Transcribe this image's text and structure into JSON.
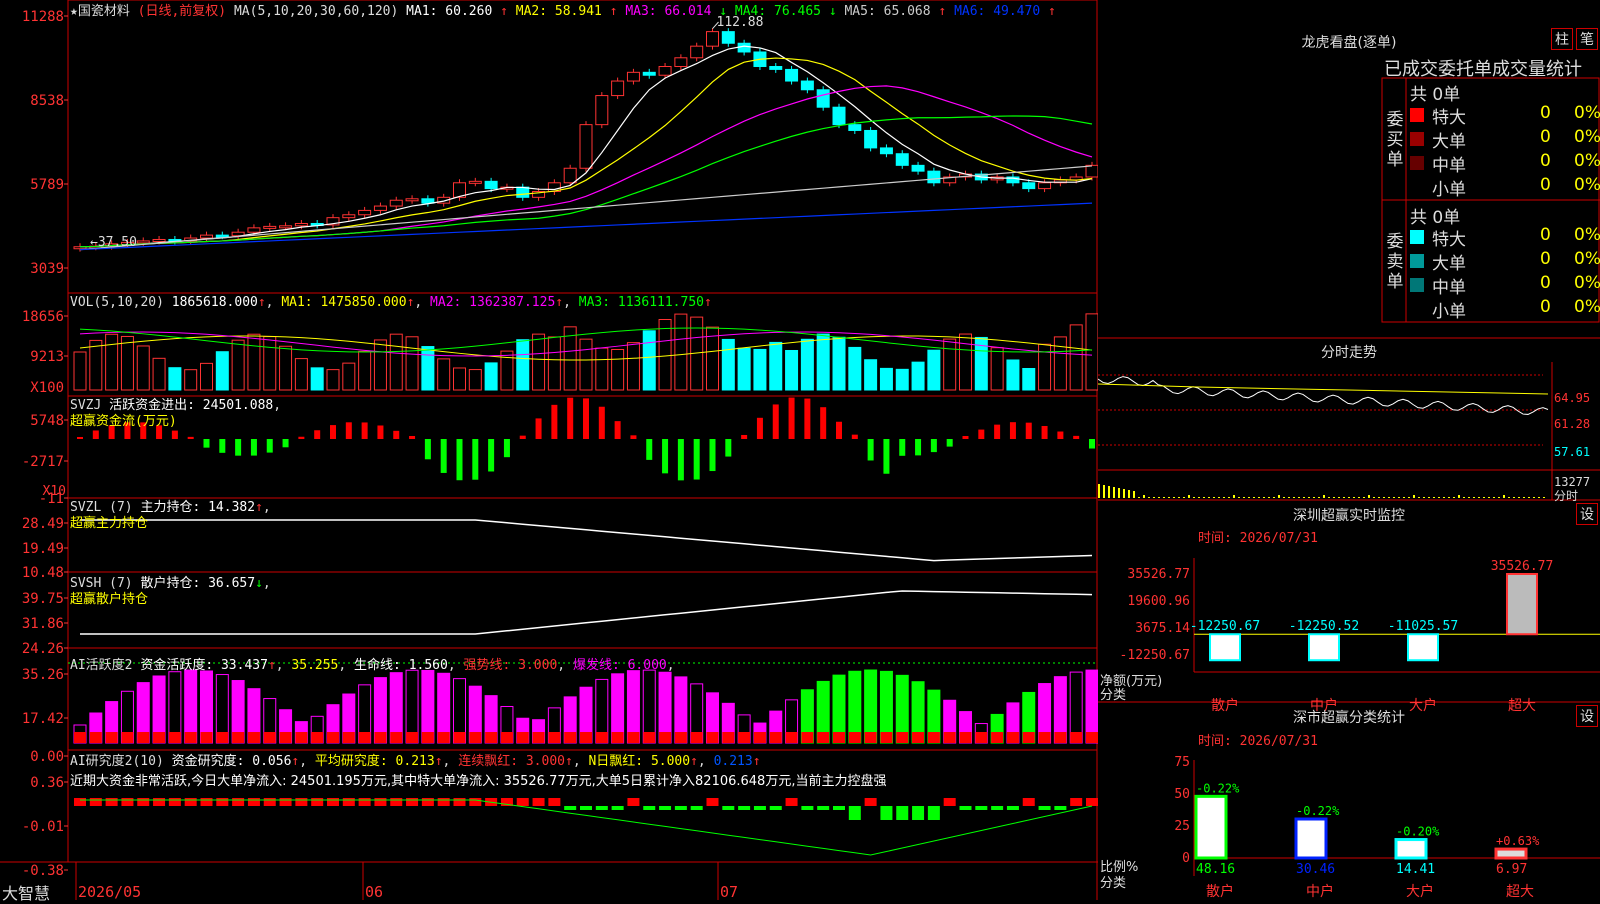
{
  "colors": {
    "up": "#ff3333",
    "down": "#00ffff",
    "red": "#ff0000",
    "green": "#00ff00",
    "magenta": "#ff00ff",
    "yellow": "#ffff00",
    "white": "#ffffff",
    "blue": "#0033ff",
    "border": "#cc0000"
  },
  "main": {
    "title": "★国瓷材料",
    "title_icon": "star-icon",
    "mode": "(日线,前复权)",
    "ma_label": "MA(5,10,20,30,60,120)",
    "ma_items": [
      {
        "text": "MA1: 60.260",
        "arrow": "↑",
        "color": "#ffffff"
      },
      {
        "text": "MA2: 58.941",
        "arrow": "↑",
        "color": "#ffff00"
      },
      {
        "text": "MA3: 66.014",
        "arrow": "↓",
        "color": "#ff00ff"
      },
      {
        "text": "MA4: 76.465",
        "arrow": "↓",
        "color": "#00ff00"
      },
      {
        "text": "MA5: 65.068",
        "arrow": "↑",
        "color": "#cccccc"
      },
      {
        "text": "MA6: 49.470",
        "arrow": "↑",
        "color": "#0033ff"
      }
    ],
    "y_ticks": [
      "11288",
      "8538",
      "5789",
      "3039"
    ],
    "high_label": "112.88",
    "low_label": "37.50",
    "volume": {
      "title": "VOL(5,10,20)",
      "value": "1865618.000",
      "arrow": "↑",
      "ma1": "MA1: 1475850.000",
      "ma2": "MA2: 1362387.125",
      "ma3": "MA3: 1136111.750",
      "y_ticks": [
        "18656",
        "9213"
      ],
      "unit": "X100"
    },
    "svzj": {
      "title": "SVZJ",
      "label": "活跃资金进出: 24501.088",
      "suffix": ",",
      "line2": "超赢资金流(万元)",
      "y_ticks": [
        "5748",
        "-2717",
        "-11"
      ],
      "unit": "X10"
    },
    "svzl": {
      "title": "SVZL (7)",
      "label": "主力持仓: 14.382",
      "arrow": "↑",
      "suffix": ",",
      "line2": "超赢主力持仓",
      "y_ticks": [
        "28.49",
        "19.49",
        "10.48"
      ]
    },
    "svsh": {
      "title": "SVSH (7)",
      "label": "散户持仓: 36.657",
      "arrow": "↓",
      "suffix": ",",
      "line2": "超赢散户持仓",
      "y_ticks": [
        "39.75",
        "31.86",
        "24.26"
      ]
    },
    "ai_active": {
      "title": "AI活跃度2",
      "label": "资金活跃度: 33.437",
      "arrow1": "↑",
      "v2": "35.255",
      "life": "生命线: 1.560",
      "strong": "强势线: 3.000",
      "burst": "爆发线: 6.000",
      "y_ticks": [
        "35.26",
        "17.42",
        "0.00"
      ]
    },
    "ai_research": {
      "title": "AI研究度2(10)",
      "label": "资金研究度: 0.056",
      "arrow1": "↑",
      "avg": "平均研究度: 0.213",
      "consec": "连续飘红: 3.000",
      "nday": "N日飘红: 5.000",
      "last": "0.213",
      "summary": "近期大资金非常活跃,今日大单净流入: 24501.195万元,其中特大单净流入: 35526.77万元,大单5日累计净入82106.648万元,当前主力控盘强",
      "y_ticks": [
        "0.36",
        "-0.01",
        "-0.38"
      ]
    },
    "x_labels": [
      "2026/05",
      "06",
      "07"
    ],
    "brand": "大智慧",
    "lock_icon": "lock-icon"
  },
  "right": {
    "lhb_title": "龙虎看盘(逐单)",
    "btn_bar": "柱",
    "btn_pen": "笔",
    "stats_header": "已成交委托单成交量统计",
    "buy": {
      "side": "委买单",
      "total": "共 0单",
      "rows": [
        {
          "label": "特大",
          "count": "0",
          "pct": "0%",
          "color": "#ff0000"
        },
        {
          "label": "大单",
          "count": "0",
          "pct": "0%",
          "color": "#990000"
        },
        {
          "label": "中单",
          "count": "0",
          "pct": "0%",
          "color": "#660000"
        },
        {
          "label": "小单",
          "count": "0",
          "pct": "0%",
          "color": ""
        }
      ]
    },
    "sell": {
      "side": "委卖单",
      "total": "共 0单",
      "rows": [
        {
          "label": "特大",
          "count": "0",
          "pct": "0%",
          "color": "#00ffff"
        },
        {
          "label": "大单",
          "count": "0",
          "pct": "0%",
          "color": "#009999"
        },
        {
          "label": "中单",
          "count": "0",
          "pct": "0%",
          "color": "#007777"
        },
        {
          "label": "小单",
          "count": "0",
          "pct": "0%",
          "color": ""
        }
      ]
    },
    "intraday": {
      "title": "分时走势",
      "price_ticks": [
        "64.95",
        "61.28",
        "57.61"
      ],
      "vol_tick": "13277",
      "vol_unit": "分时"
    },
    "sz_monitor": {
      "title": "深圳超赢实时监控",
      "btn": "设",
      "time": "时间: 2026/07/31",
      "y_ticks": [
        "35526.77",
        "19600.96",
        "3675.14",
        "-12250.67"
      ],
      "y_label": "净额(万元)",
      "x_label_title": "分类",
      "categories": [
        "散户",
        "中户",
        "大户",
        "超大"
      ],
      "values": [
        -12250.67,
        -12250.52,
        -11025.57,
        35526.77
      ],
      "value_labels": [
        "-12250.67",
        "-12250.52",
        "-11025.57",
        "35526.77"
      ]
    },
    "sz_class": {
      "title": "深市超赢分类统计",
      "btn": "设",
      "time": "时间: 2026/07/31",
      "y_ticks": [
        "75",
        "50",
        "25",
        "0"
      ],
      "y_label": "比例%",
      "x_label_title": "分类",
      "categories": [
        "散户",
        "中户",
        "大户",
        "超大"
      ],
      "values": [
        48.16,
        30.46,
        14.41,
        6.97
      ],
      "changes": [
        "-0.22%",
        "-0.22%",
        "-0.20%",
        "+0.63%"
      ],
      "value_labels": [
        "48.16",
        "30.46",
        "14.41",
        "6.97"
      ]
    }
  },
  "chart_data": [
    {
      "type": "candlestick",
      "title": "★国瓷材料 (日线,前复权)",
      "ylabel": "",
      "ylim": [
        3039,
        11288
      ],
      "x_ticks": [
        "2026/05",
        "06",
        "07"
      ],
      "series": [
        {
          "open": [
            37.5,
            38.0,
            38.2,
            39.0,
            39.5,
            40.0,
            40.5,
            40.0,
            41.0,
            42.0,
            41.8,
            43.0,
            44.5,
            45.0,
            45.2,
            46.0,
            45.5,
            48.0,
            49.0,
            50.5,
            52.0,
            54.0,
            54.5,
            53.0,
            55.0,
            60.0,
            60.5,
            58.0,
            58.5,
            55.0,
            57.0,
            60.0,
            65.0,
            80.0,
            90.0,
            95.0,
            98.0,
            97.0,
            100.0,
            103.0,
            107.0,
            112.0,
            108.0,
            105.0,
            100.0,
            99.0,
            95.0,
            92.0,
            86.0,
            80.0,
            78.0,
            72.0,
            70.0,
            66.0,
            64.0,
            60.0,
            62.0,
            63.0,
            61.0,
            62.0,
            60.0,
            58.0,
            60.0,
            61.0,
            62.0
          ],
          "close": [
            38.0,
            38.2,
            39.0,
            39.5,
            40.0,
            40.5,
            40.0,
            41.0,
            42.0,
            41.8,
            43.0,
            44.5,
            45.0,
            45.2,
            46.0,
            45.5,
            48.0,
            49.0,
            50.5,
            52.0,
            54.0,
            54.5,
            53.0,
            55.0,
            60.0,
            60.5,
            58.0,
            58.5,
            55.0,
            57.0,
            60.0,
            65.0,
            80.0,
            90.0,
            95.0,
            98.0,
            97.0,
            100.0,
            103.0,
            107.0,
            112.0,
            108.0,
            105.0,
            100.0,
            99.0,
            95.0,
            92.0,
            86.0,
            80.0,
            78.0,
            72.0,
            70.0,
            66.0,
            64.0,
            60.0,
            62.0,
            63.0,
            61.0,
            62.0,
            60.0,
            58.0,
            60.0,
            61.0,
            62.0,
            66.0
          ],
          "high_marked": 112.88,
          "low_marked": 37.5
        }
      ]
    },
    {
      "type": "bar",
      "title": "VOL(5,10,20)",
      "ylim": [
        0,
        18656
      ],
      "last_value": 1865618.0,
      "ma": [
        1475850.0,
        1362387.125,
        1136111.75
      ]
    }
  ]
}
